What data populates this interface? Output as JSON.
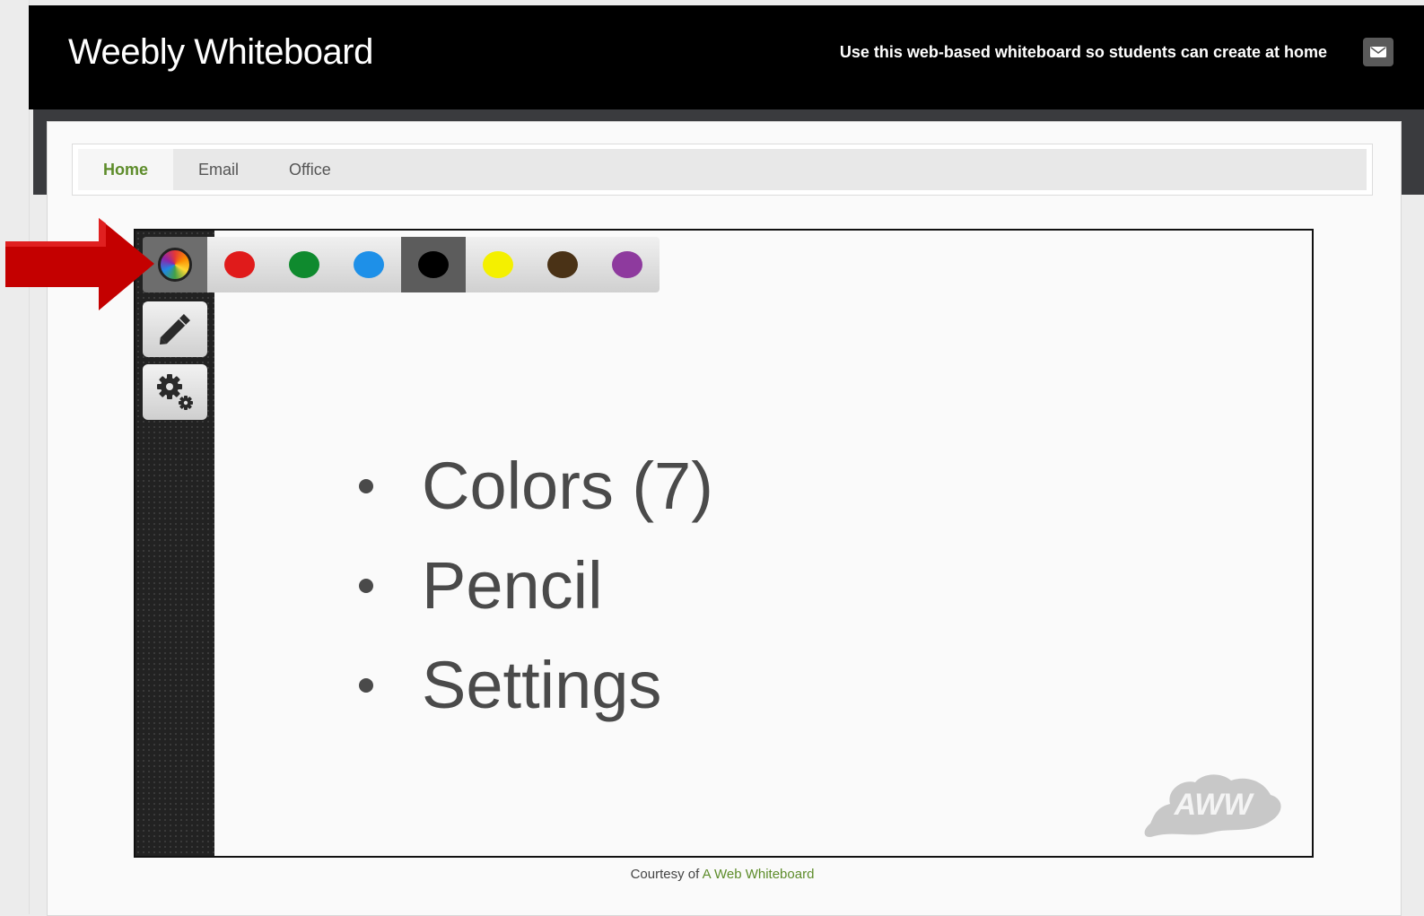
{
  "header": {
    "title": "Weebly Whiteboard",
    "tagline": "Use this web-based whiteboard so students can create at home",
    "mail_icon": "envelope-icon"
  },
  "nav": {
    "tabs": [
      {
        "label": "Home",
        "active": true
      },
      {
        "label": "Email",
        "active": false
      },
      {
        "label": "Office",
        "active": false
      }
    ]
  },
  "toolbar": {
    "palette": [
      {
        "name": "color-wheel",
        "color": "multicolor",
        "selected": false
      },
      {
        "name": "red",
        "color": "#e01b1b",
        "selected": false
      },
      {
        "name": "green",
        "color": "#0f8a2e",
        "selected": false
      },
      {
        "name": "blue",
        "color": "#1e90e8",
        "selected": false
      },
      {
        "name": "black",
        "color": "#000000",
        "selected": true
      },
      {
        "name": "yellow",
        "color": "#f4f000",
        "selected": false
      },
      {
        "name": "brown",
        "color": "#4a3216",
        "selected": false
      },
      {
        "name": "purple",
        "color": "#8e3a9e",
        "selected": false
      }
    ],
    "tools": [
      {
        "name": "pencil",
        "icon": "pencil-icon"
      },
      {
        "name": "settings",
        "icon": "gear-icon"
      }
    ]
  },
  "annotation": {
    "bullets": [
      "Colors (7)",
      "Pencil",
      "Settings"
    ],
    "arrow_color": "#d40000"
  },
  "board": {
    "logo_text": "AWW"
  },
  "footer": {
    "prefix": "Courtesy of",
    "link": "A Web Whiteboard"
  }
}
